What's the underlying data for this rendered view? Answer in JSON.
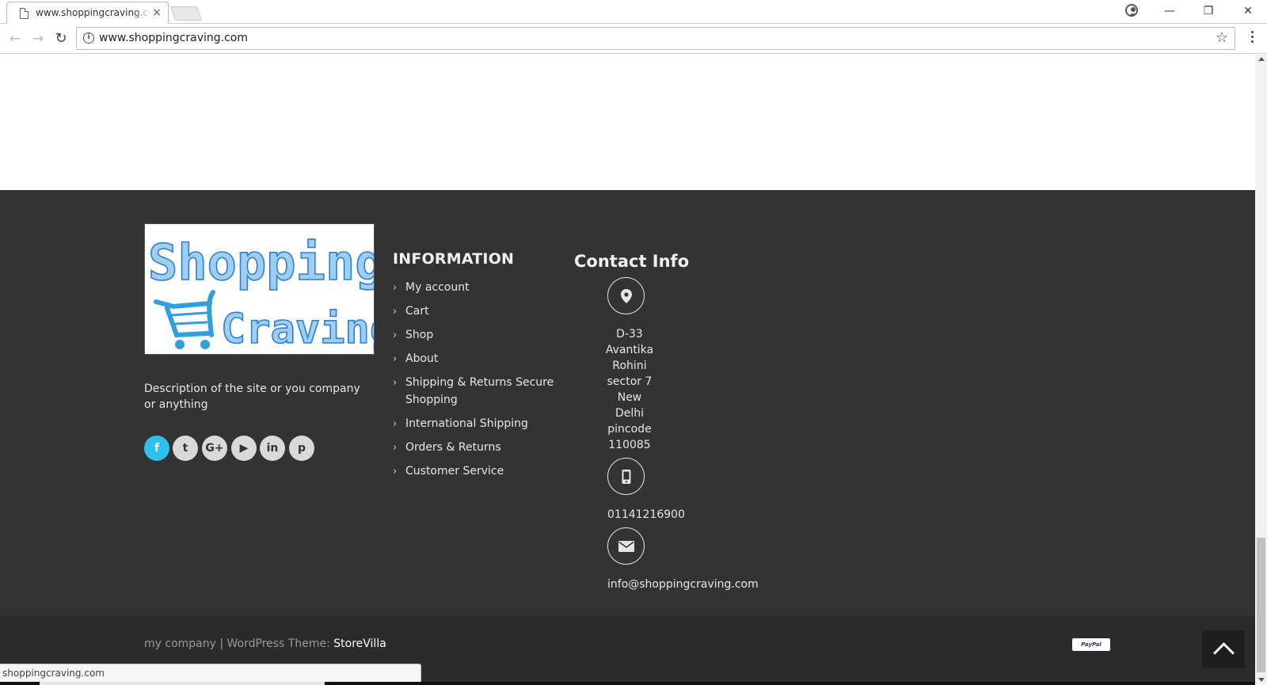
{
  "browser": {
    "tab_title": "www.shoppingcraving.com",
    "tab_close": "×",
    "url": "www.shoppingcraving.com",
    "window_controls": {
      "minimize": "—",
      "restore": "❐",
      "close": "✕"
    },
    "status_text": "shoppingcraving.com"
  },
  "footer": {
    "logo": {
      "line1": "Shopping",
      "line2": "Craving"
    },
    "description": "Description of the site or you company or anything",
    "social": [
      "f",
      "t",
      "G+",
      "▶",
      "in",
      "p"
    ],
    "information": {
      "heading": "INFORMATION",
      "items": [
        "My account",
        "Cart",
        "Shop",
        "About",
        "Shipping & Returns Secure Shopping",
        "International Shipping",
        "Orders & Returns",
        "Customer Service"
      ]
    },
    "contact": {
      "heading": "Contact Info",
      "address_lines": [
        "D-33",
        "Avantika",
        "Rohini",
        "sector 7",
        "New",
        "Delhi",
        "pincode",
        "110085"
      ],
      "phone": "01141216900",
      "email": "info@shoppingcraving.com"
    },
    "bottom": {
      "company": "my company",
      "separator": " | WordPress Theme: ",
      "theme": "StoreVilla",
      "payment_badge": "PayPal"
    }
  },
  "colors": {
    "footer_bg": "#333333",
    "bottom_bar_bg": "#2b2b2b",
    "facebook": "#2fc0ef",
    "logo_blue": "#2f9fe0"
  }
}
